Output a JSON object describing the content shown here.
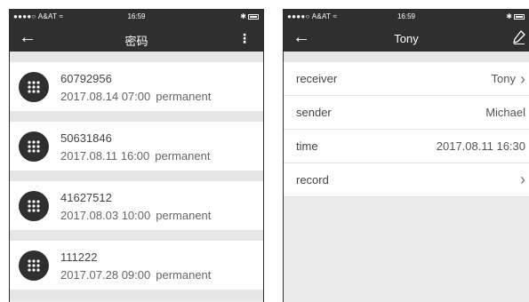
{
  "left": {
    "status": {
      "carrier": "●●●●○ A&AT ≈",
      "time": "16:59"
    },
    "nav": {
      "back_icon": "←",
      "title": "密码",
      "more_icon": "⋮"
    },
    "items": [
      {
        "code": "60792956",
        "date": "2017.08.14",
        "time": "07:00",
        "type": "permanent"
      },
      {
        "code": "50631846",
        "date": "2017.08.11",
        "time": "16:00",
        "type": "permanent"
      },
      {
        "code": "41627512",
        "date": "2017.08.03",
        "time": "10:00",
        "type": "permanent"
      },
      {
        "code": "111222",
        "date": "2017.07.28",
        "time": "09:00",
        "type": "permanent"
      }
    ]
  },
  "right": {
    "status": {
      "carrier": "●●●●○ A&AT ≈",
      "time": "16:59"
    },
    "nav": {
      "back_icon": "←",
      "title": "Tony",
      "edit_icon": "pencil-icon"
    },
    "rows": {
      "receiver": {
        "label": "receiver",
        "value": "Tony",
        "chevron": "›"
      },
      "sender": {
        "label": "sender",
        "value": "Michael"
      },
      "time": {
        "label": "time",
        "value": "2017.08.11 16:30"
      },
      "record": {
        "label": "record",
        "chevron": "›"
      }
    }
  }
}
